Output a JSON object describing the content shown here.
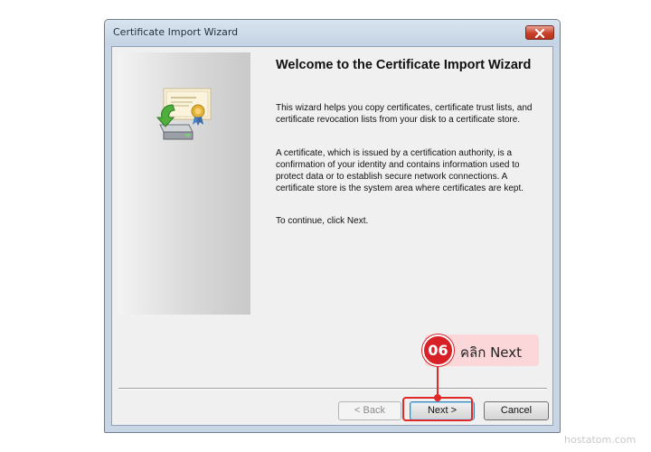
{
  "window": {
    "title": "Certificate Import Wizard"
  },
  "content": {
    "heading": "Welcome to the Certificate Import Wizard",
    "paragraph_1": "This wizard helps you copy certificates, certificate trust lists, and certificate revocation lists from your disk to a certificate store.",
    "paragraph_2": "A certificate, which is issued by a certification authority, is a confirmation of your identity and contains information used to protect data or to establish secure network connections. A certificate store is the system area where certificates are kept.",
    "paragraph_3": "To continue, click Next."
  },
  "buttons": {
    "back": "< Back",
    "next": "Next >",
    "cancel": "Cancel"
  },
  "annotation": {
    "step": "06",
    "text": "คลิก Next",
    "color": "#d72127"
  },
  "watermark": "hostatom.com",
  "icons": {
    "close": "close-icon",
    "wizard": "certificate-import-icon"
  }
}
